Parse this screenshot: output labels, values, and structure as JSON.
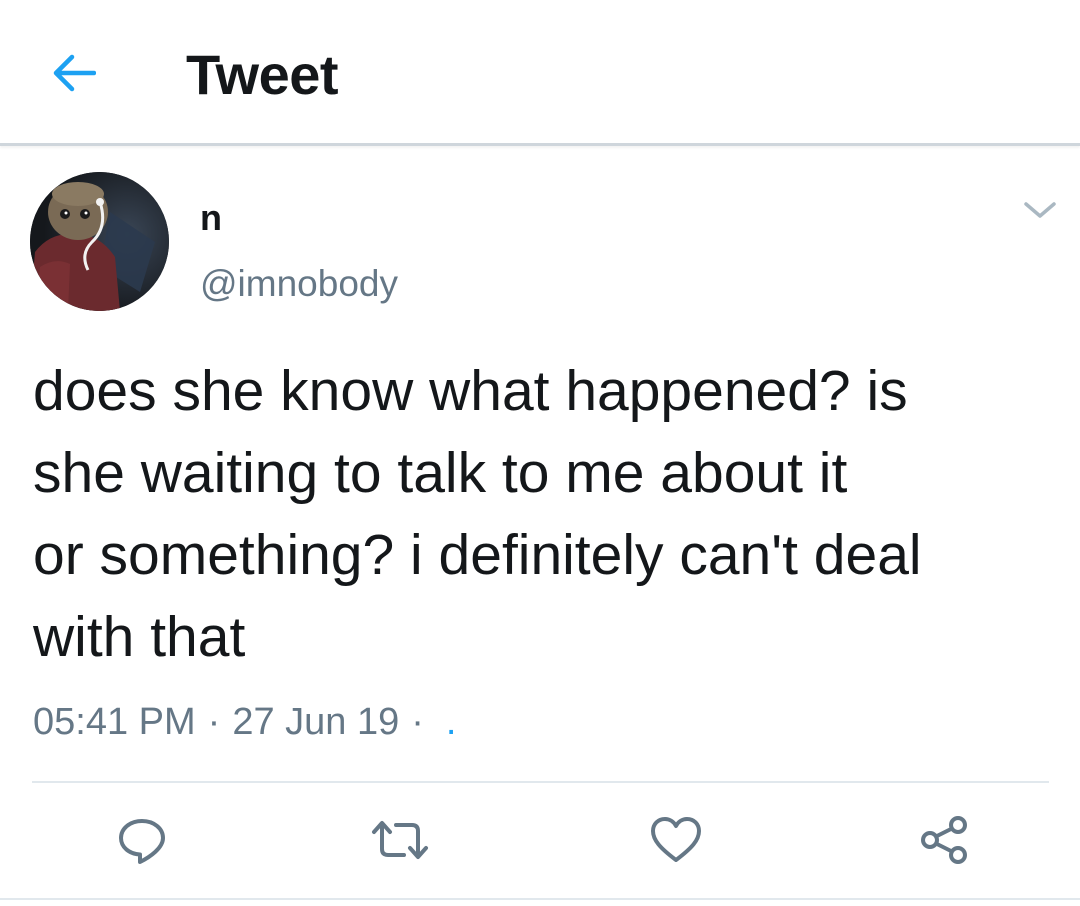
{
  "header": {
    "title": "Tweet",
    "back_icon": "arrow-left-icon"
  },
  "tweet": {
    "user": {
      "name": "n",
      "handle": "@imnobody",
      "avatar_icon": "profile-photo"
    },
    "text": "does she know what happened? is\nshe waiting to talk to me about it\nor something? i definitely can't deal\nwith that",
    "time": "05:41 PM",
    "separator": "·",
    "date": "27 Jun 19",
    "source_separator": "·",
    "source": "."
  },
  "actions": {
    "reply_icon": "reply-icon",
    "retweet_icon": "retweet-icon",
    "like_icon": "heart-icon",
    "share_icon": "share-icon"
  },
  "colors": {
    "accent": "#1da1f2",
    "text": "#14171a",
    "muted": "#657786"
  }
}
